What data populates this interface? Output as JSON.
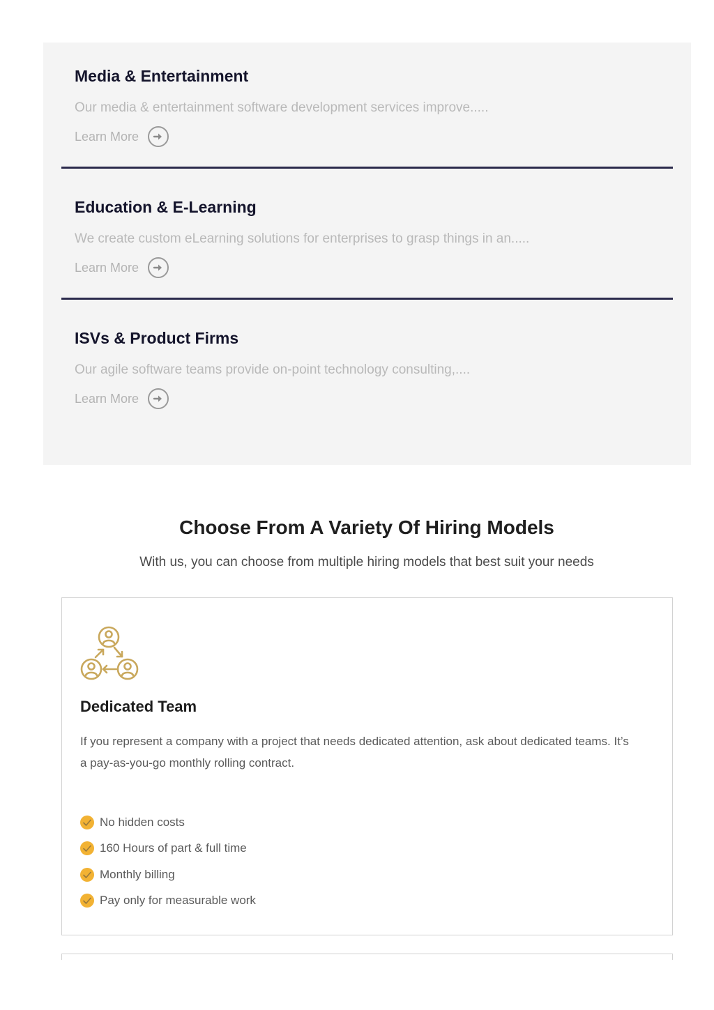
{
  "industries": [
    {
      "title": "Media & Entertainment",
      "description": "Our media & entertainment software development services improve.....",
      "link_label": "Learn More"
    },
    {
      "title": "Education & E-Learning",
      "description": "We create custom eLearning solutions for enterprises to grasp things in an.....",
      "link_label": "Learn More"
    },
    {
      "title": "ISVs & Product Firms",
      "description": "Our agile software teams provide on-point technology consulting,....",
      "link_label": "Learn More"
    }
  ],
  "hiring": {
    "title": "Choose From A Variety Of Hiring Models",
    "subtitle": "With us, you can choose from multiple hiring models that best suit your needs",
    "cards": [
      {
        "icon": "team-exchange-icon",
        "title": "Dedicated Team",
        "description": "If you represent a company with a project that needs dedicated attention, ask about dedicated teams. It’s a pay-as-you-go monthly rolling contract.",
        "features": [
          "No hidden costs",
          "160 Hours of part & full time",
          "Monthly billing",
          "Pay only for measurable work"
        ]
      }
    ]
  },
  "colors": {
    "accent_gold": "#c9a85c",
    "check_badge": "#f2b233",
    "divider": "#2b2a4c",
    "panel_bg": "#f4f4f4"
  }
}
